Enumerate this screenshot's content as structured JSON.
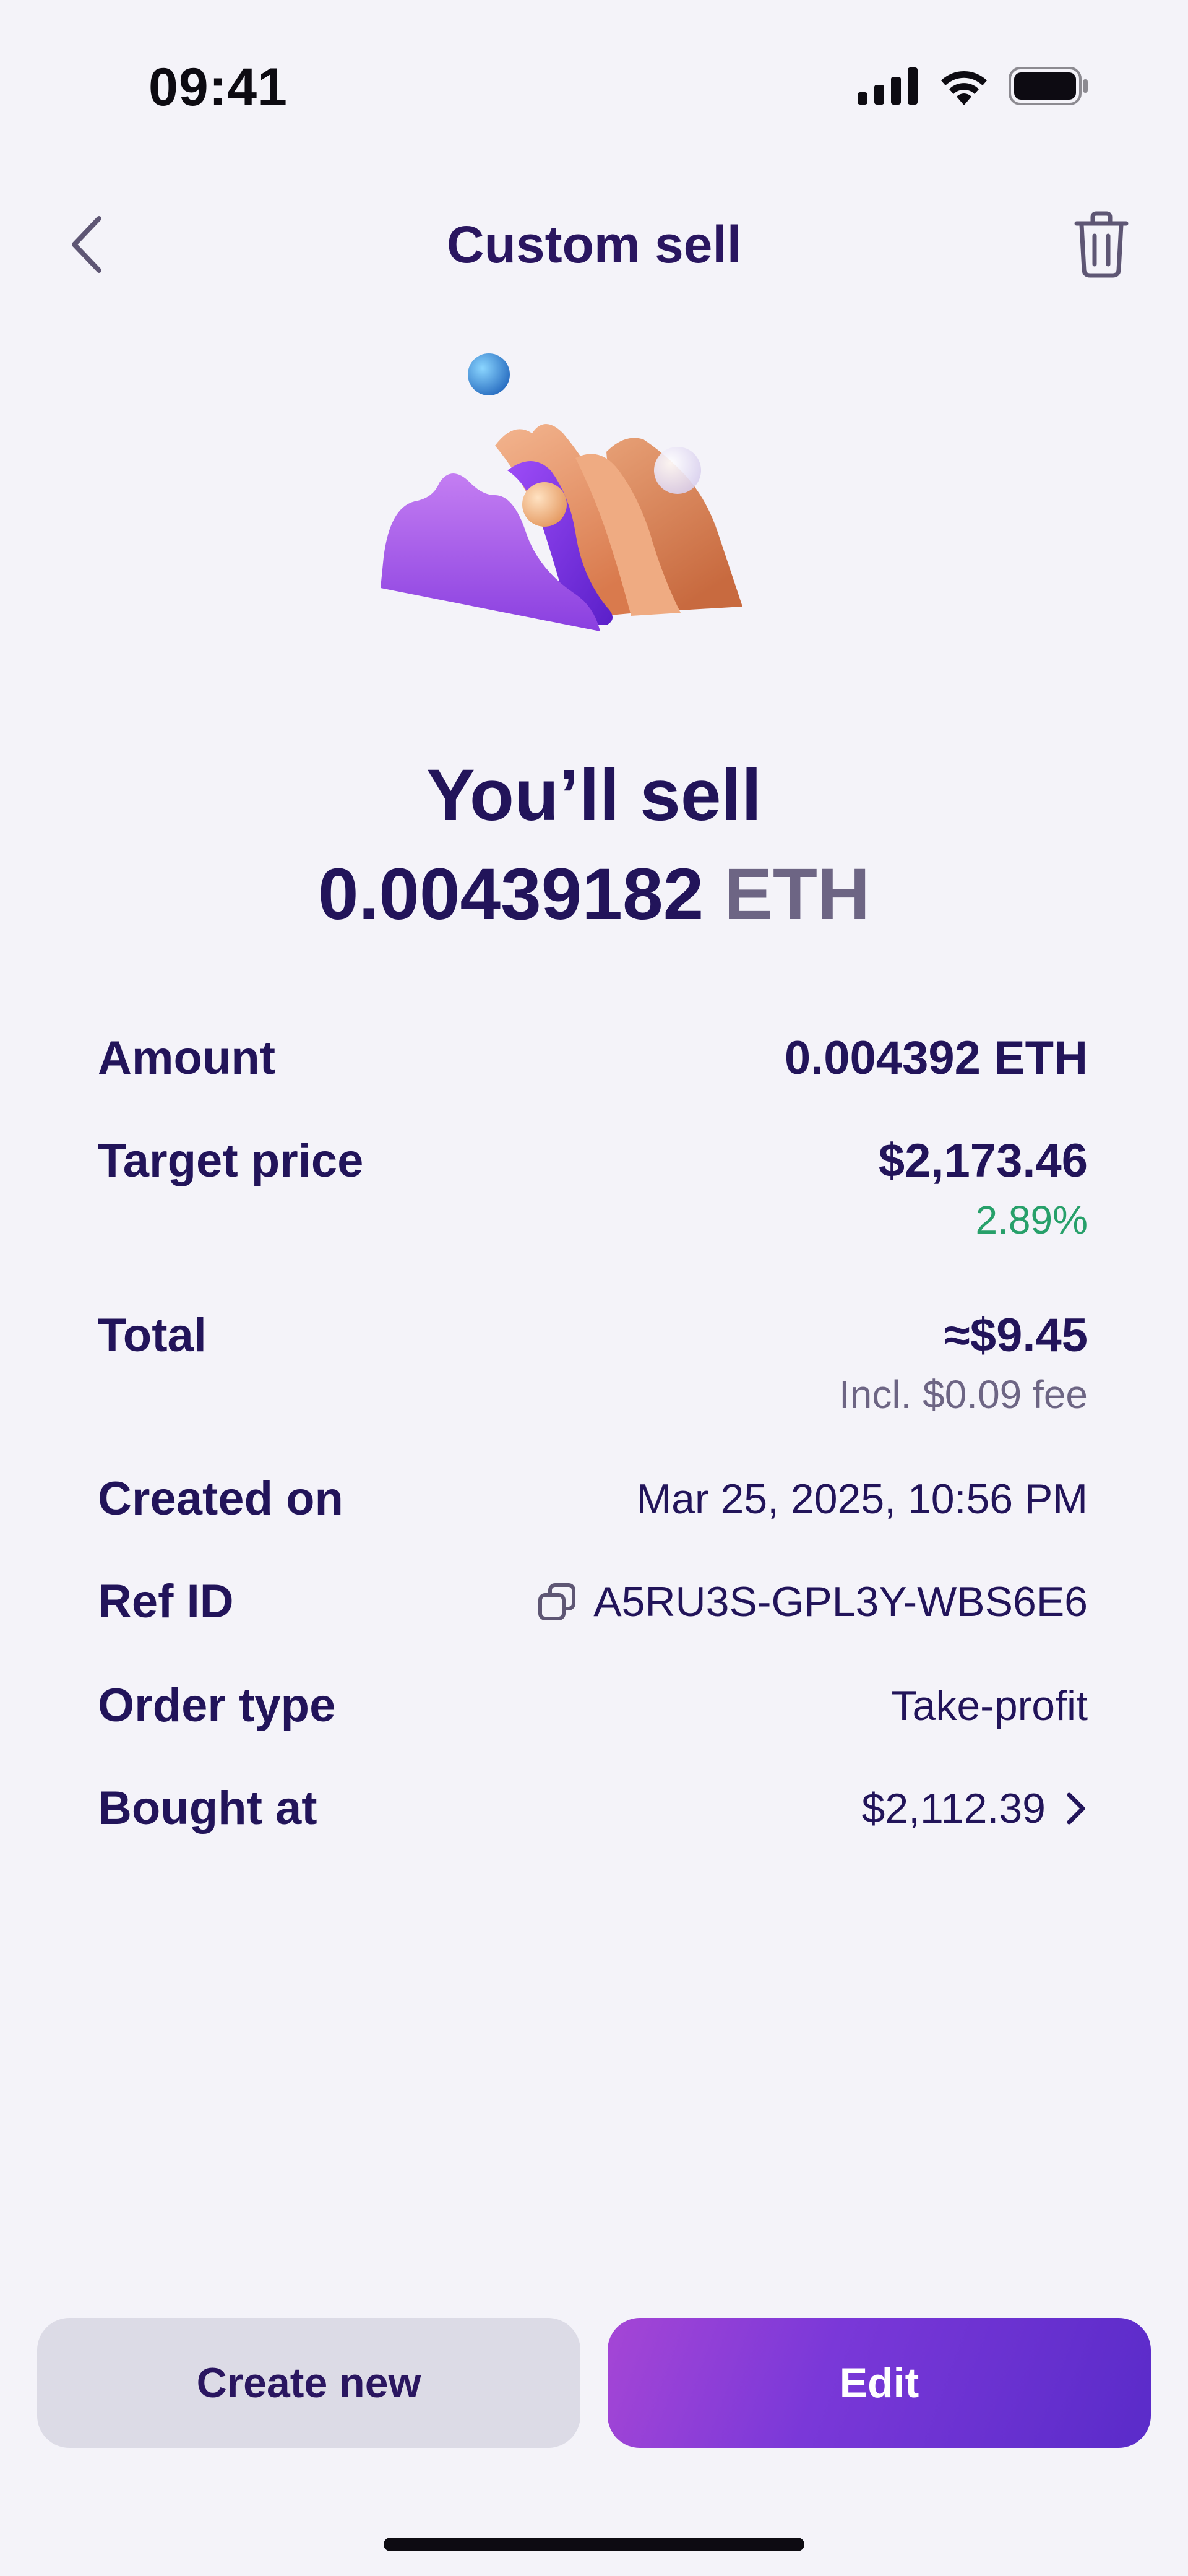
{
  "status_bar": {
    "time": "09:41",
    "icons": [
      "cellular-signal-icon",
      "wifi-icon",
      "battery-icon"
    ]
  },
  "header": {
    "title": "Custom sell",
    "back_icon": "chevron-left-icon",
    "delete_icon": "trash-icon"
  },
  "hero": {
    "line1": "You’ll sell",
    "amount": "0.00439182",
    "unit": "ETH"
  },
  "details": {
    "amount": {
      "label": "Amount",
      "value": "0.004392 ETH"
    },
    "target_price": {
      "label": "Target price",
      "value": "$2,173.46",
      "change": "2.89%"
    },
    "total": {
      "label": "Total",
      "value": "≈$9.45",
      "fee": "Incl. $0.09 fee"
    },
    "created_on": {
      "label": "Created on",
      "value": "Mar 25, 2025, 10:56 PM"
    },
    "ref_id": {
      "label": "Ref ID",
      "value": "A5RU3S-GPL3Y-WBS6E6",
      "icon": "copy-icon"
    },
    "order_type": {
      "label": "Order type",
      "value": "Take-profit"
    },
    "bought_at": {
      "label": "Bought at",
      "value": "$2,112.39",
      "icon": "chevron-right-icon"
    }
  },
  "actions": {
    "create_new": "Create new",
    "edit": "Edit"
  },
  "colors": {
    "background": "#f4f3f9",
    "primary_text": "#22145a",
    "positive": "#27a06a",
    "muted": "#6d6584",
    "accent_start": "#a546d6",
    "accent_end": "#5a2bc9"
  }
}
